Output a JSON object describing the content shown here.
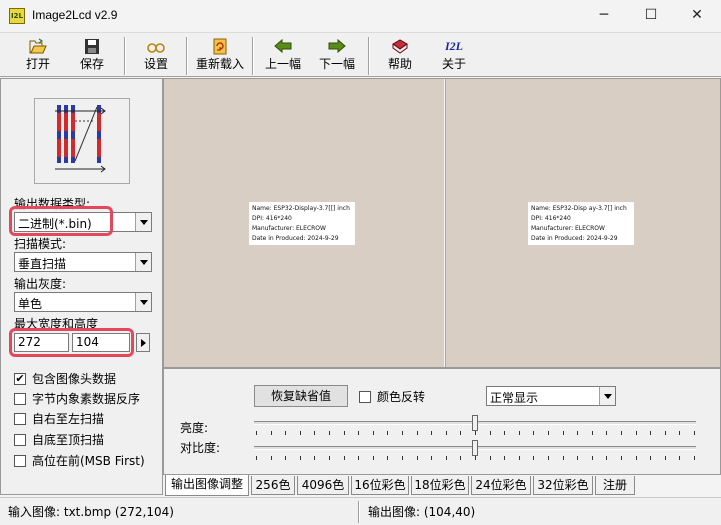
{
  "window": {
    "title": "Image2Lcd v2.9",
    "icon": "I2L",
    "controls": [
      "─",
      "☐",
      "✕"
    ]
  },
  "toolbar": {
    "open": "打开",
    "save": "保存",
    "settings": "设置",
    "reload": "重新载入",
    "prev": "上一幅",
    "next": "下一幅",
    "help": "帮助",
    "about": "关于",
    "about_icon_text": "I2L"
  },
  "left": {
    "output_type_label": "输出数据类型:",
    "output_type_value": "二进制(*.bin)",
    "scan_mode_label": "扫描模式:",
    "scan_mode_value": "垂直扫描",
    "gray_label": "输出灰度:",
    "gray_value": "单色",
    "max_size_label": "最大宽度和高度",
    "width": "272",
    "height": "104",
    "options": [
      {
        "label": "包含图像头数据",
        "checked": true
      },
      {
        "label": "字节内象素数据反序",
        "checked": false
      },
      {
        "label": "自右至左扫描",
        "checked": false
      },
      {
        "label": "自底至顶扫描",
        "checked": false
      },
      {
        "label": "高位在前(MSB First)",
        "checked": false
      }
    ]
  },
  "images": {
    "left_lines": [
      "Name: ESP32-Display-3.7[[] inch",
      "DPI: 416*240",
      "Manufacturer: ELECROW",
      "Date in Produced: 2024-9-29"
    ],
    "right_lines": [
      "Name: ESP32-Disp ay-3.7[] inch",
      "DPI: 416*240",
      "Manufacturer: ELECROW",
      "Date in Produced: 2024-9-29"
    ]
  },
  "controls": {
    "restore_default": "恢复缺省值",
    "invert_label": "颜色反转",
    "invert_checked": false,
    "display_mode": "正常显示",
    "brightness_label": "亮度:",
    "contrast_label": "对比度:",
    "brightness_level": 0.5,
    "contrast_level": 0.5
  },
  "tabs": [
    "输出图像调整",
    "256色",
    "4096色",
    "16位彩色",
    "18位彩色",
    "24位彩色",
    "32位彩色",
    "注册"
  ],
  "status": {
    "input": "输入图像: txt.bmp (272,104)",
    "output": "输出图像: (104,40)"
  },
  "colors": {
    "highlight": "#e5485d",
    "image_bg": "#d9cec3"
  }
}
